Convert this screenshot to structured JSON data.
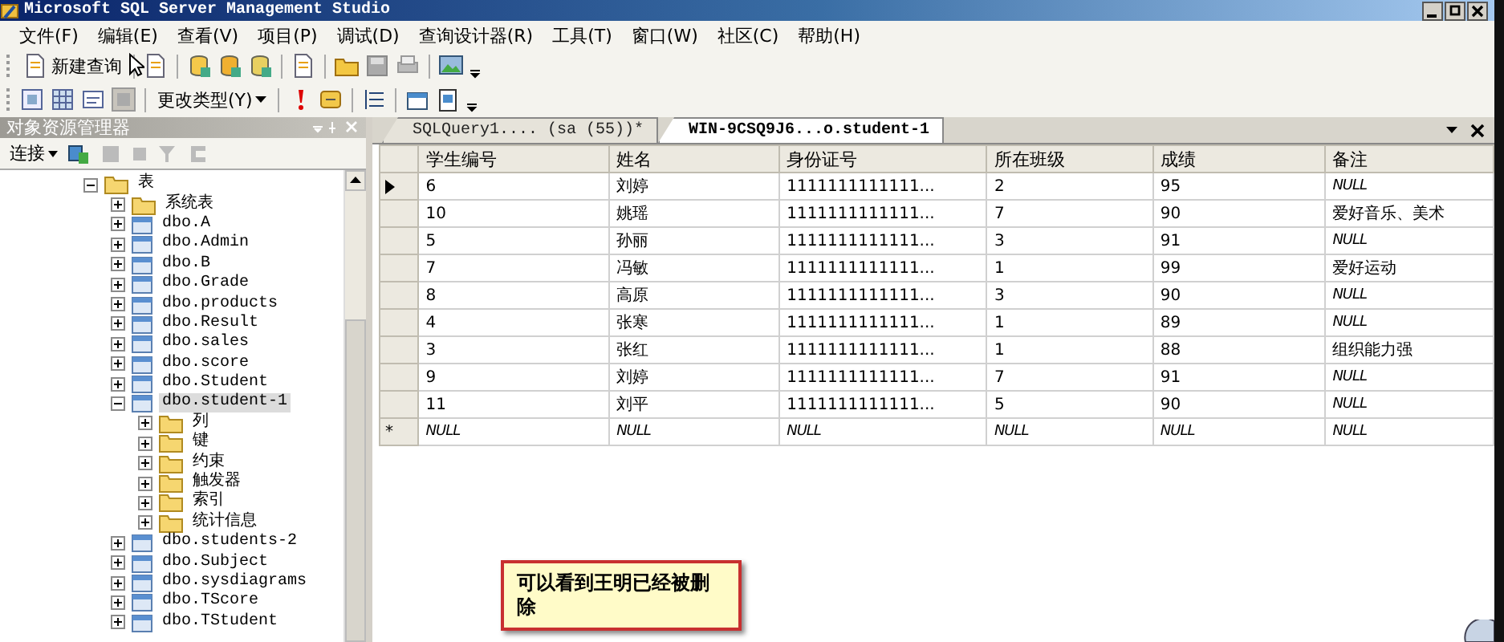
{
  "window": {
    "title": "Microsoft SQL Server Management Studio"
  },
  "menu": [
    "文件(F)",
    "编辑(E)",
    "查看(V)",
    "项目(P)",
    "调试(D)",
    "查询设计器(R)",
    "工具(T)",
    "窗口(W)",
    "社区(C)",
    "帮助(H)"
  ],
  "toolbar1": {
    "new_query": "新建查询"
  },
  "toolbar2": {
    "change_type": "更改类型(Y)"
  },
  "explorer": {
    "title": "对象资源管理器",
    "connect": "连接",
    "tree": [
      {
        "label": "表",
        "kind": "folder",
        "expanded": true,
        "selected": false,
        "children": [
          {
            "label": "系统表",
            "kind": "folder",
            "expanded": false,
            "selected": false
          },
          {
            "label": "dbo.A",
            "kind": "table",
            "expanded": false,
            "selected": false
          },
          {
            "label": "dbo.Admin",
            "kind": "table",
            "expanded": false,
            "selected": false
          },
          {
            "label": "dbo.B",
            "kind": "table",
            "expanded": false,
            "selected": false
          },
          {
            "label": "dbo.Grade",
            "kind": "table",
            "expanded": false,
            "selected": false
          },
          {
            "label": "dbo.products",
            "kind": "table",
            "expanded": false,
            "selected": false
          },
          {
            "label": "dbo.Result",
            "kind": "table",
            "expanded": false,
            "selected": false
          },
          {
            "label": "dbo.sales",
            "kind": "table",
            "expanded": false,
            "selected": false
          },
          {
            "label": "dbo.score",
            "kind": "table",
            "expanded": false,
            "selected": false
          },
          {
            "label": "dbo.Student",
            "kind": "table",
            "expanded": false,
            "selected": false
          },
          {
            "label": "dbo.student-1",
            "kind": "table",
            "expanded": true,
            "selected": true,
            "children": [
              {
                "label": "列",
                "kind": "folder",
                "expanded": false,
                "selected": false
              },
              {
                "label": "键",
                "kind": "folder",
                "expanded": false,
                "selected": false
              },
              {
                "label": "约束",
                "kind": "folder",
                "expanded": false,
                "selected": false
              },
              {
                "label": "触发器",
                "kind": "folder",
                "expanded": false,
                "selected": false
              },
              {
                "label": "索引",
                "kind": "folder",
                "expanded": false,
                "selected": false
              },
              {
                "label": "统计信息",
                "kind": "folder",
                "expanded": false,
                "selected": false
              }
            ]
          },
          {
            "label": "dbo.students-2",
            "kind": "table",
            "expanded": false,
            "selected": false
          },
          {
            "label": "dbo.Subject",
            "kind": "table",
            "expanded": false,
            "selected": false
          },
          {
            "label": "dbo.sysdiagrams",
            "kind": "table",
            "expanded": false,
            "selected": false
          },
          {
            "label": "dbo.TScore",
            "kind": "table",
            "expanded": false,
            "selected": false
          },
          {
            "label": "dbo.TStudent",
            "kind": "table",
            "expanded": false,
            "selected": false
          }
        ]
      }
    ]
  },
  "tabs": [
    {
      "label": "SQLQuery1.... (sa (55))*",
      "selected": false
    },
    {
      "label": "WIN-9CSQ9J6...o.student-1",
      "selected": true
    }
  ],
  "grid": {
    "columns": [
      "学生编号",
      "姓名",
      "身份证号",
      "所在班级",
      "成绩",
      "备注"
    ],
    "rows": [
      {
        "kind": "data",
        "current": true,
        "cells": [
          "6",
          "刘婷",
          "1111111111111...",
          "2",
          "95",
          {
            "text": "NULL",
            "null": true
          }
        ]
      },
      {
        "kind": "data",
        "current": false,
        "cells": [
          "10",
          "姚瑶",
          "1111111111111...",
          "7",
          "90",
          "爱好音乐、美术"
        ]
      },
      {
        "kind": "data",
        "current": false,
        "cells": [
          "5",
          "孙丽",
          "1111111111111...",
          "3",
          "91",
          {
            "text": "NULL",
            "null": true
          }
        ]
      },
      {
        "kind": "data",
        "current": false,
        "cells": [
          "7",
          "冯敏",
          "1111111111111...",
          "1",
          "99",
          "爱好运动"
        ]
      },
      {
        "kind": "data",
        "current": false,
        "cells": [
          "8",
          "高原",
          "1111111111111...",
          "3",
          "90",
          {
            "text": "NULL",
            "null": true
          }
        ]
      },
      {
        "kind": "data",
        "current": false,
        "cells": [
          "4",
          "张寒",
          "1111111111111...",
          "1",
          "89",
          {
            "text": "NULL",
            "null": true
          }
        ]
      },
      {
        "kind": "data",
        "current": false,
        "cells": [
          "3",
          "张红",
          "1111111111111...",
          "1",
          "88",
          "组织能力强"
        ]
      },
      {
        "kind": "data",
        "current": false,
        "cells": [
          "9",
          "刘婷",
          "1111111111111...",
          "7",
          "91",
          {
            "text": "NULL",
            "null": true
          }
        ]
      },
      {
        "kind": "data",
        "current": false,
        "cells": [
          "11",
          "刘平",
          "1111111111111...",
          "5",
          "90",
          {
            "text": "NULL",
            "null": true
          }
        ]
      },
      {
        "kind": "new",
        "marker": "*",
        "current": false,
        "cells": [
          {
            "text": "NULL",
            "null": true
          },
          {
            "text": "NULL",
            "null": true
          },
          {
            "text": "NULL",
            "null": true
          },
          {
            "text": "NULL",
            "null": true
          },
          {
            "text": "NULL",
            "null": true
          },
          {
            "text": "NULL",
            "null": true
          }
        ]
      }
    ]
  },
  "callout": {
    "text": "可以看到王明已经被删除"
  }
}
